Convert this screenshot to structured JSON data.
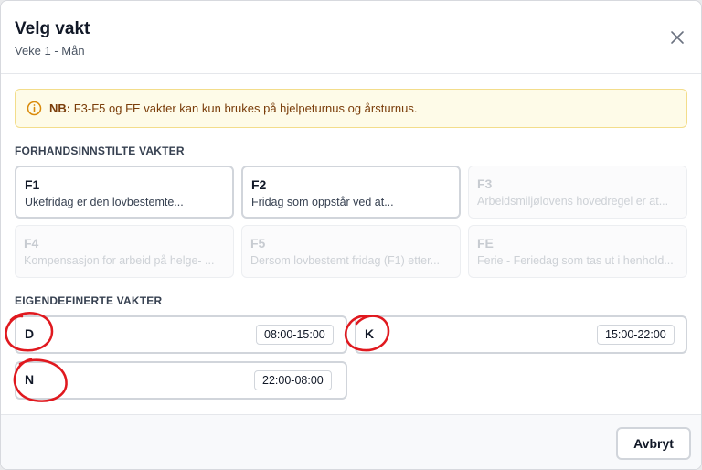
{
  "dialog": {
    "title": "Velg vakt",
    "subtitle": "Veke 1 - Mån"
  },
  "notice": {
    "icon": "info-icon",
    "prefix": "NB:",
    "text": " F3-F5 og FE vakter kan kun brukes på hjelpeturnus og årsturnus."
  },
  "preset": {
    "heading": "FORHANDSINNSTILTE VAKTER",
    "items": [
      {
        "code": "F1",
        "description": "Ukefridag er den lovbestemte...",
        "enabled": true
      },
      {
        "code": "F2",
        "description": "Fridag som oppstår ved at...",
        "enabled": true
      },
      {
        "code": "F3",
        "description": "Arbeidsmiljølovens hovedregel er at...",
        "enabled": false
      },
      {
        "code": "F4",
        "description": "Kompensasjon for arbeid på helge- ...",
        "enabled": false
      },
      {
        "code": "F5",
        "description": "Dersom lovbestemt fridag (F1) etter...",
        "enabled": false
      },
      {
        "code": "FE",
        "description": "Ferie - Feriedag som tas ut i henhold...",
        "enabled": false
      }
    ]
  },
  "custom": {
    "heading": "EIGENDEFINERTE VAKTER",
    "items": [
      {
        "code": "D",
        "time": "08:00-15:00"
      },
      {
        "code": "K",
        "time": "15:00-22:00"
      },
      {
        "code": "N",
        "time": "22:00-08:00"
      }
    ]
  },
  "footer": {
    "cancel_label": "Avbryt"
  },
  "colors": {
    "notice_bg": "#fefbe8",
    "notice_text": "#7a3d0a",
    "annotation": "#e0191f"
  }
}
